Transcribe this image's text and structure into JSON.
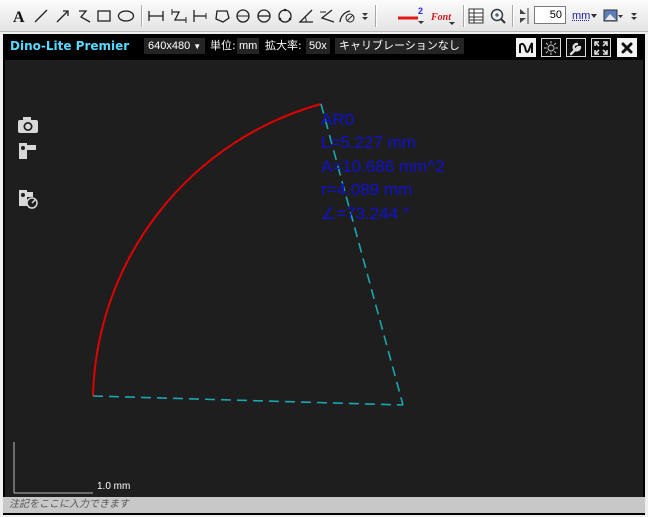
{
  "toolbar": {
    "tools": [
      {
        "name": "text-tool"
      },
      {
        "name": "line-tool"
      },
      {
        "name": "arrow-tool"
      },
      {
        "name": "polyline-tool"
      },
      {
        "name": "rectangle-tool"
      },
      {
        "name": "ellipse-tool"
      },
      {
        "name": "measure-line-tool"
      },
      {
        "name": "measure-polyline-tool"
      },
      {
        "name": "parallel-tool"
      },
      {
        "name": "polygon-tool"
      },
      {
        "name": "circle-tool"
      },
      {
        "name": "circle-diameter-tool"
      },
      {
        "name": "circle-3point-tool"
      },
      {
        "name": "angle-tool"
      },
      {
        "name": "angle-3point-tool"
      },
      {
        "name": "arc-tool"
      },
      {
        "name": "more-tools-dropdown"
      }
    ],
    "line_width_label": "2",
    "font_label": "Font",
    "zoom_value": "50",
    "unit_label": "mm"
  },
  "viewer": {
    "brand": "Dino-Lite Premier",
    "resolution": "640x480",
    "unit_text": "単位:",
    "unit_value": "mm",
    "magnification_text": "拡大率:",
    "magnification_value": "50x",
    "calibration_text": "キャリブレーションなし",
    "scale_bar_label": "1.0 mm",
    "status_placeholder": "注記をここに入力できます"
  },
  "measurement": {
    "label": "AR0",
    "lines": [
      "L=5.227 mm",
      "A=10.686 mm^2",
      "r=4.089 mm",
      "∠=73.244 °"
    ],
    "colors": {
      "arc": "#e00000",
      "radius": "#1aa7b0",
      "text": "#1010d0"
    }
  }
}
